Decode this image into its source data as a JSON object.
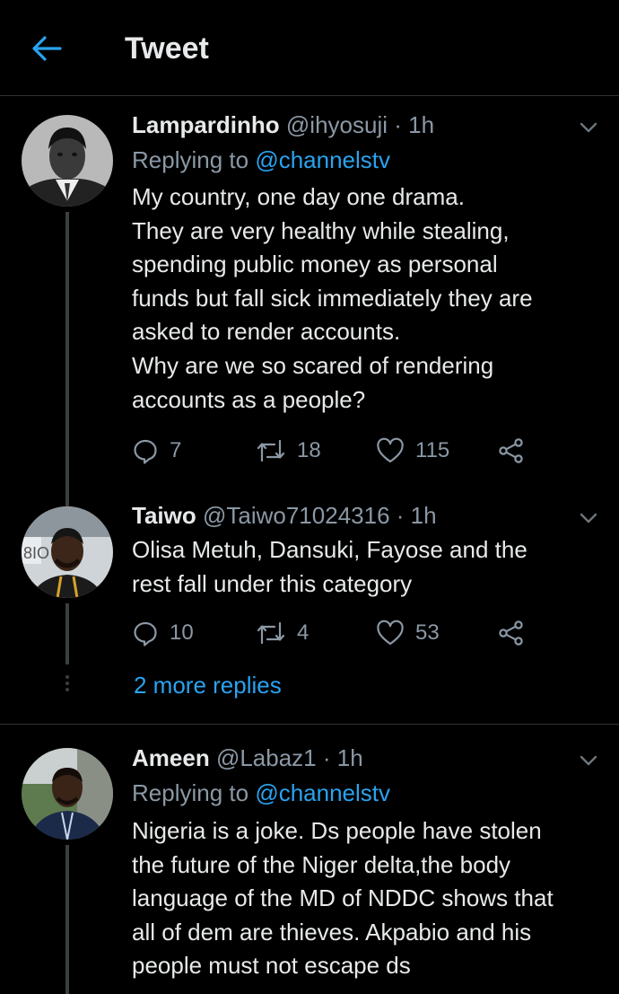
{
  "header": {
    "title": "Tweet"
  },
  "tweets": [
    {
      "name": "Lampardinho",
      "handle": "@ihyosuji",
      "time": "· 1h",
      "replying_prefix": "Replying to",
      "replying_to": "@channelstv",
      "lines": [
        "My country, one day one drama.",
        "They are very healthy while stealing,",
        "spending public money as personal",
        "funds but fall sick immediately they are",
        "asked to render accounts.",
        "Why are we so scared of rendering",
        "accounts as a people?"
      ],
      "replies": "7",
      "retweets": "18",
      "likes": "115"
    },
    {
      "name": "Taiwo",
      "handle": "@Taiwo71024316",
      "time": "· 1h",
      "lines": [
        "Olisa Metuh, Dansuki, Fayose and the",
        "rest fall under this category"
      ],
      "replies": "10",
      "retweets": "4",
      "likes": "53"
    },
    {
      "name": "Ameen",
      "handle": "@Labaz1",
      "time": "· 1h",
      "replying_prefix": "Replying to",
      "replying_to": "@channelstv",
      "lines": [
        "Nigeria is a joke. Ds people have stolen",
        "the future of the Niger delta,the body",
        "language of the MD of NDDC shows that",
        "all of dem are thieves. Akpabio and his",
        "people must not escape ds"
      ]
    }
  ],
  "thread": {
    "more_replies": "2 more replies"
  },
  "colors": {
    "accent": "#2aa3ef",
    "muted": "#8b98a5",
    "background": "#000000"
  },
  "icons": [
    "back-arrow-icon",
    "chevron-down-icon",
    "reply-icon",
    "retweet-icon",
    "like-icon",
    "share-icon"
  ]
}
